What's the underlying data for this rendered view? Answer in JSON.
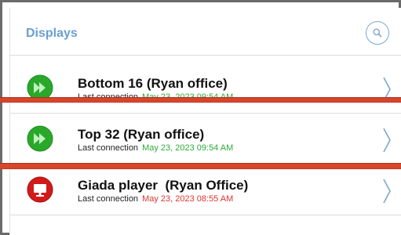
{
  "header": {
    "title": "Displays",
    "search_icon": "search-icon"
  },
  "colors": {
    "online": "#2aa82a",
    "offline": "#d11a1a",
    "accent": "#6a9fd0",
    "timestamp_ok": "#2faa3a",
    "timestamp_stale": "#e0342f"
  },
  "displays": [
    {
      "name": "Bottom 16 (Ryan office)",
      "last_connection_label": "Last connection",
      "last_connection": "May 23, 2023 09:54 AM",
      "status_icon": "fast-forward-icon"
    },
    {
      "name": "Top 32 (Ryan office)",
      "last_connection_label": "Last connection",
      "last_connection": "May 23, 2023 09:54 AM",
      "status_icon": "fast-forward-icon"
    },
    {
      "name": "Giada player  (Ryan Office)",
      "last_connection_label": "Last connection",
      "last_connection": "May 23, 2023 08:55 AM",
      "status_icon": "monitor-icon"
    }
  ]
}
